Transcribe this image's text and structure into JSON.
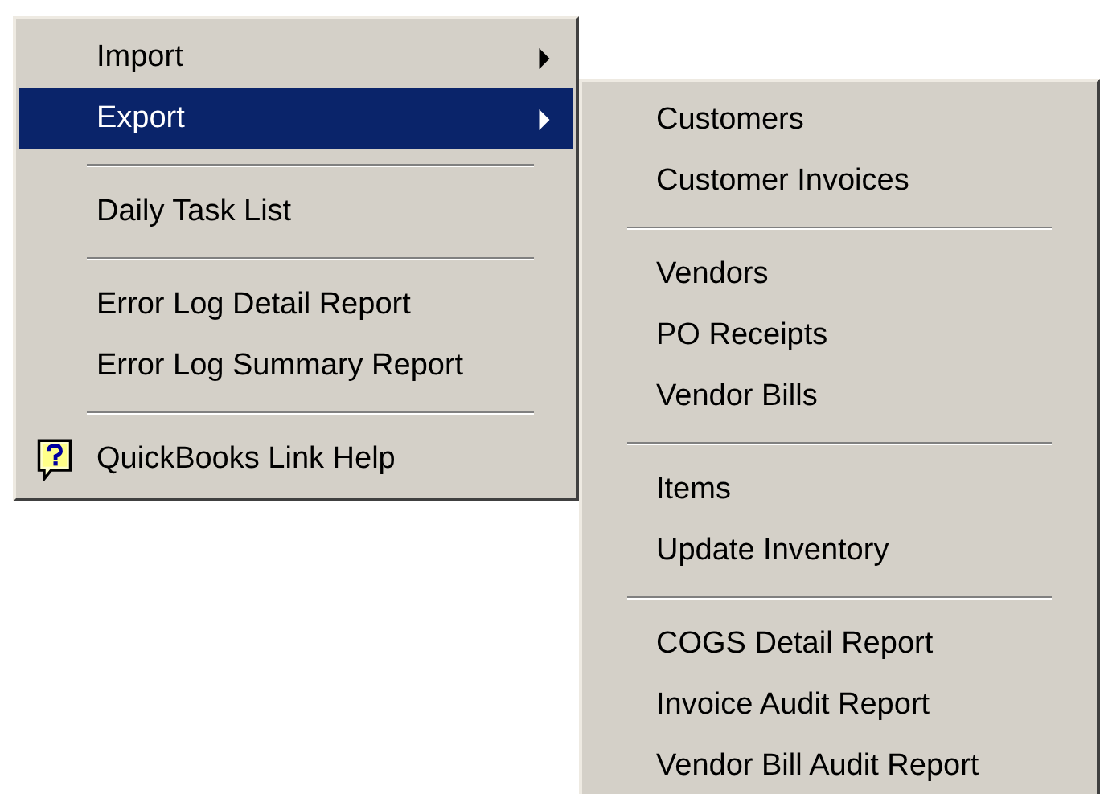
{
  "menu": {
    "items": [
      {
        "kind": "item",
        "label": "Import",
        "submenu": true,
        "selected": false
      },
      {
        "kind": "item",
        "label": "Export",
        "submenu": true,
        "selected": true
      },
      {
        "kind": "separator"
      },
      {
        "kind": "item",
        "label": "Daily Task List",
        "submenu": false,
        "selected": false
      },
      {
        "kind": "separator"
      },
      {
        "kind": "item",
        "label": "Error Log Detail Report",
        "submenu": false,
        "selected": false
      },
      {
        "kind": "item",
        "label": "Error Log Summary Report",
        "submenu": false,
        "selected": false
      },
      {
        "kind": "separator"
      },
      {
        "kind": "help",
        "label": "QuickBooks Link Help",
        "submenu": false,
        "selected": false
      }
    ]
  },
  "submenu": {
    "items": [
      {
        "kind": "item",
        "label": "Customers",
        "selected": false
      },
      {
        "kind": "item",
        "label": "Customer Invoices",
        "selected": false
      },
      {
        "kind": "separator"
      },
      {
        "kind": "item",
        "label": "Vendors",
        "selected": false
      },
      {
        "kind": "item",
        "label": "PO Receipts",
        "selected": false
      },
      {
        "kind": "item",
        "label": "Vendor Bills",
        "selected": false
      },
      {
        "kind": "separator"
      },
      {
        "kind": "item",
        "label": "Items",
        "selected": false
      },
      {
        "kind": "item",
        "label": "Update Inventory",
        "selected": false
      },
      {
        "kind": "separator"
      },
      {
        "kind": "item",
        "label": "COGS Detail Report",
        "selected": false
      },
      {
        "kind": "item",
        "label": "Invoice Audit Report",
        "selected": false
      },
      {
        "kind": "item",
        "label": "Vendor Bill Audit Report",
        "selected": false
      }
    ]
  }
}
